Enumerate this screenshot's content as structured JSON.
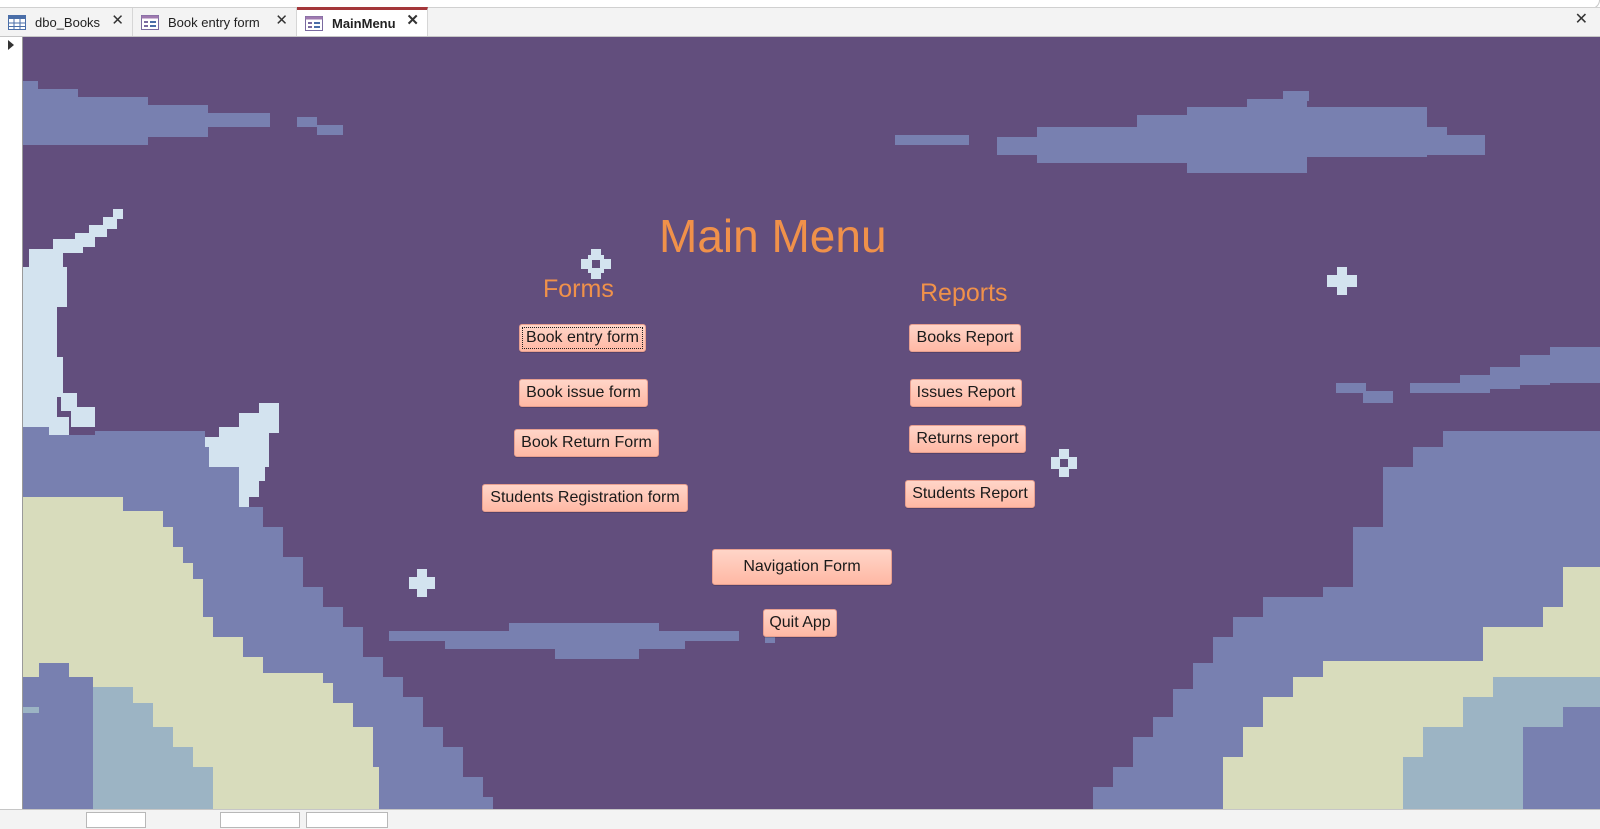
{
  "tabs": [
    {
      "label": "dbo_Books",
      "icon": "table-icon",
      "active": false
    },
    {
      "label": "Book entry form",
      "icon": "form-icon",
      "active": false
    },
    {
      "label": "MainMenu",
      "icon": "form-icon",
      "active": true
    }
  ],
  "form": {
    "title": "Main Menu",
    "forms_heading": "Forms",
    "reports_heading": "Reports",
    "form_buttons": [
      "Book entry form",
      "Book issue form",
      "Book Return Form",
      "Students Registration form"
    ],
    "report_buttons": [
      "Books Report",
      "Issues Report",
      "Returns report",
      "Students Report"
    ],
    "navigation_button": "Navigation Form",
    "quit_button": "Quit App"
  },
  "colors": {
    "background": "#624e7d",
    "heading": "#f0914a",
    "button_fill": "#ffc3b2",
    "cloud": "#7880b0",
    "moon": "#d3e3ef",
    "hill_light": "#d8dcbc",
    "hill_blue": "#9cb4c4",
    "active_tab_accent": "#a4373a"
  }
}
